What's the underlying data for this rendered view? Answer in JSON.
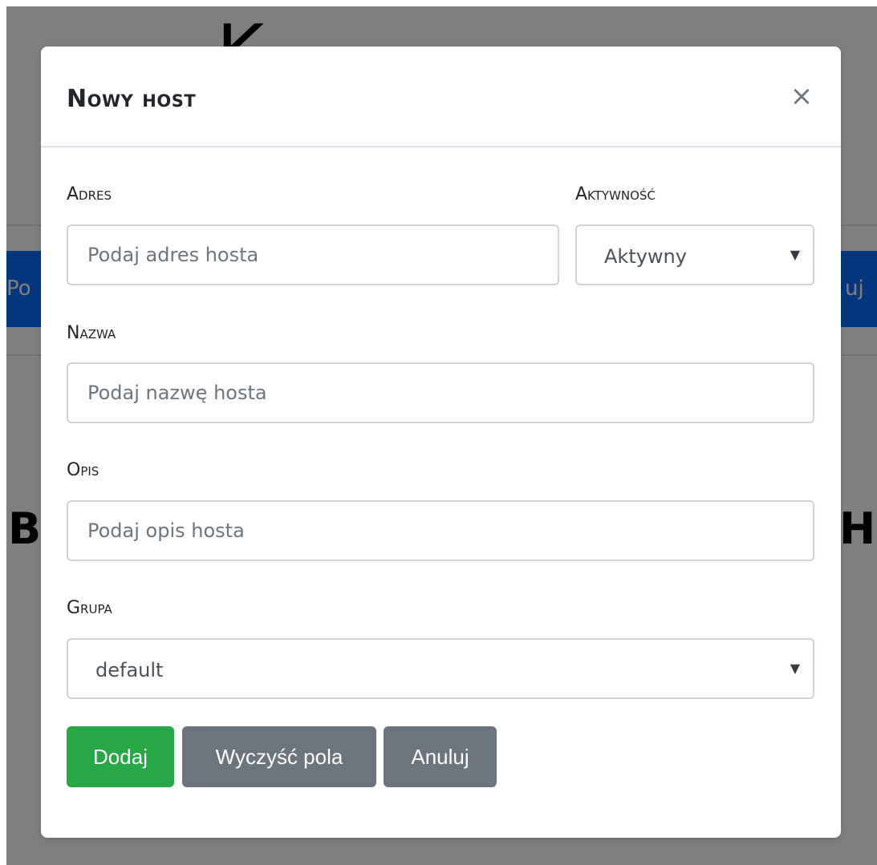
{
  "background": {
    "top_glyph": "K",
    "nav_left_text": "Po",
    "nav_right_text": "uj",
    "heading_left": "B",
    "heading_right": "H"
  },
  "modal": {
    "title": "Nowy host",
    "close_symbol": "×",
    "fields": {
      "address": {
        "label": "Adres",
        "placeholder": "Podaj adres hosta",
        "value": ""
      },
      "activity": {
        "label": "Aktywność",
        "selected": "Aktywny"
      },
      "name": {
        "label": "Nazwa",
        "placeholder": "Podaj nazwę hosta",
        "value": ""
      },
      "description": {
        "label": "Opis",
        "placeholder": "Podaj opis hosta",
        "value": ""
      },
      "group": {
        "label": "Grupa",
        "selected": "default"
      }
    },
    "buttons": {
      "add": "Dodaj",
      "clear": "Wyczyść pola",
      "cancel": "Anuluj"
    }
  },
  "colors": {
    "success": "#28a745",
    "secondary": "#6c757d",
    "primary_nav": "#0d6efd",
    "border": "#ced4da"
  }
}
